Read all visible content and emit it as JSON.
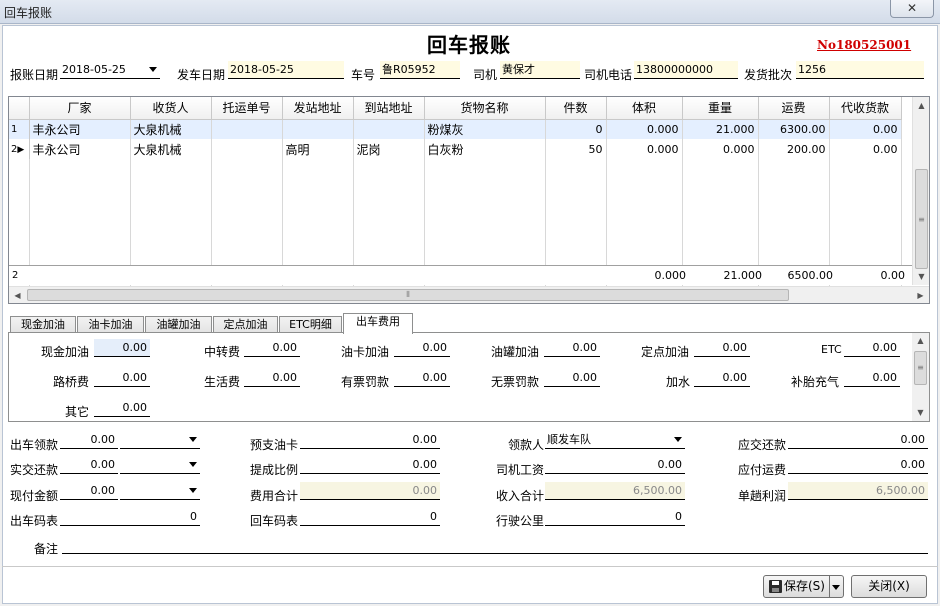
{
  "window": {
    "title": "回车报账",
    "close_label": "✕"
  },
  "form": {
    "title": "回车报账",
    "number": "No180525001"
  },
  "header": {
    "report_date_label": "报账日期",
    "report_date": "2018-05-25",
    "depart_date_label": "发车日期",
    "depart_date": "2018-05-25",
    "plate_label": "车号",
    "plate": "鲁R05952",
    "driver_label": "司机",
    "driver": "黄保才",
    "phone_label": "司机电话",
    "phone": "13800000000",
    "batch_label": "发货批次",
    "batch": "1256"
  },
  "grid": {
    "columns": [
      "厂家",
      "收货人",
      "托运单号",
      "发站地址",
      "到站地址",
      "货物名称",
      "件数",
      "体积",
      "重量",
      "运费",
      "代收货款"
    ],
    "rows": [
      {
        "no": "1",
        "marker": "",
        "cells": [
          "丰永公司",
          "大泉机械",
          "",
          "",
          "",
          "粉煤灰",
          "0",
          "0.000",
          "21.000",
          "6300.00",
          "0.00"
        ]
      },
      {
        "no": "2",
        "marker": "▶",
        "cells": [
          "丰永公司",
          "大泉机械",
          "",
          "高明",
          "泥岗",
          "白灰粉",
          "50",
          "0.000",
          "0.000",
          "200.00",
          "0.00"
        ]
      }
    ],
    "summary": {
      "count": "2",
      "volume": "0.000",
      "weight": "21.000",
      "freight": "6500.00",
      "collect": "0.00"
    },
    "vscroll_grip": "≡",
    "hscroll_grip": "⦀"
  },
  "tabs": [
    "现金加油",
    "油卡加油",
    "油罐加油",
    "定点加油",
    "ETC明细",
    "出车费用"
  ],
  "active_tab": 5,
  "expenses": {
    "cash_fuel_label": "现金加油",
    "cash_fuel": "0.00",
    "transfer_label": "中转费",
    "transfer": "0.00",
    "card_fuel_label": "油卡加油",
    "card_fuel": "0.00",
    "tank_fuel_label": "油罐加油",
    "tank_fuel": "0.00",
    "fixed_fuel_label": "定点加油",
    "fixed_fuel": "0.00",
    "etc_label": "ETC",
    "etc": "0.00",
    "toll_label": "路桥费",
    "toll": "0.00",
    "living_label": "生活费",
    "living": "0.00",
    "fine_ticket_label": "有票罚款",
    "fine_ticket": "0.00",
    "fine_noticket_label": "无票罚款",
    "fine_noticket": "0.00",
    "water_label": "加水",
    "water": "0.00",
    "tire_label": "补胎充气",
    "tire": "0.00",
    "other_label": "其它",
    "other": "0.00"
  },
  "summary": {
    "advance_label": "出车领款",
    "advance": "0.00",
    "prepaid_card_label": "预支油卡",
    "prepaid_card": "0.00",
    "payee_label": "领款人",
    "payee": "顺发车队",
    "should_return_label": "应交还款",
    "should_return": "0.00",
    "actual_return_label": "实交还款",
    "actual_return": "0.00",
    "commission_label": "提成比例",
    "commission": "0.00",
    "wage_label": "司机工资",
    "wage": "0.00",
    "payable_freight_label": "应付运费",
    "payable_freight": "0.00",
    "cash_paid_label": "现付金额",
    "cash_paid": "0.00",
    "expense_total_label": "费用合计",
    "expense_total": "0.00",
    "income_total_label": "收入合计",
    "income_total": "6,500.00",
    "profit_label": "单趟利润",
    "profit": "6,500.00",
    "odo_out_label": "出车码表",
    "odo_out": "0",
    "odo_in_label": "回车码表",
    "odo_in": "0",
    "mileage_label": "行驶公里",
    "mileage": "0",
    "remark_label": "备注"
  },
  "buttons": {
    "save": "保存(S)",
    "close": "关闭(X)"
  }
}
